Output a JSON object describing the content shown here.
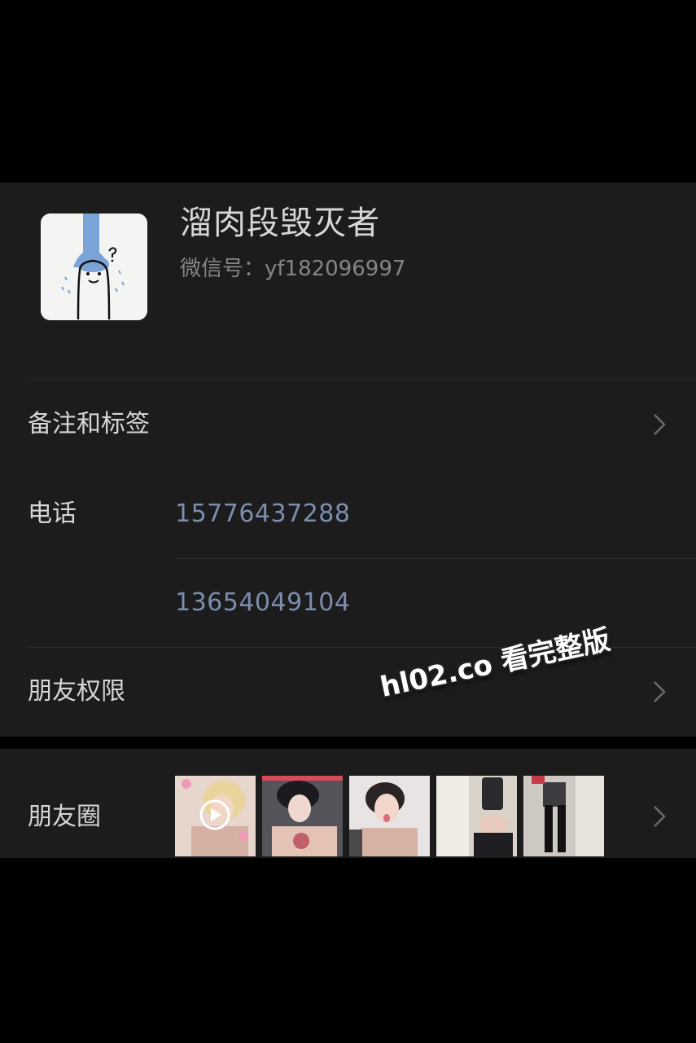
{
  "profile": {
    "nickname": "溜肉段毁灭者",
    "wechat_id": "微信号：yf182096997",
    "avatar": "doodle-figure-avatar"
  },
  "rows": {
    "remarks_label": "备注和标签",
    "phone_label": "电话",
    "phones": [
      "15776437288",
      "13654049104"
    ],
    "friend_permissions_label": "朋友权限",
    "moments_label": "朋友圈"
  },
  "watermark": "hl02.co 看完整版",
  "moments": {
    "thumbnails": [
      "video-thumbnail",
      "photo-thumbnail",
      "photo-thumbnail",
      "photo-thumbnail",
      "photo-thumbnail"
    ],
    "has_video_badge": true
  },
  "colors": {
    "background": "#000000",
    "panel": "#1c1c1c",
    "primary_text": "#d6d6d6",
    "secondary_text": "#858585",
    "phone_link": "#7c8db0",
    "chevron": "#6a6a6a"
  }
}
